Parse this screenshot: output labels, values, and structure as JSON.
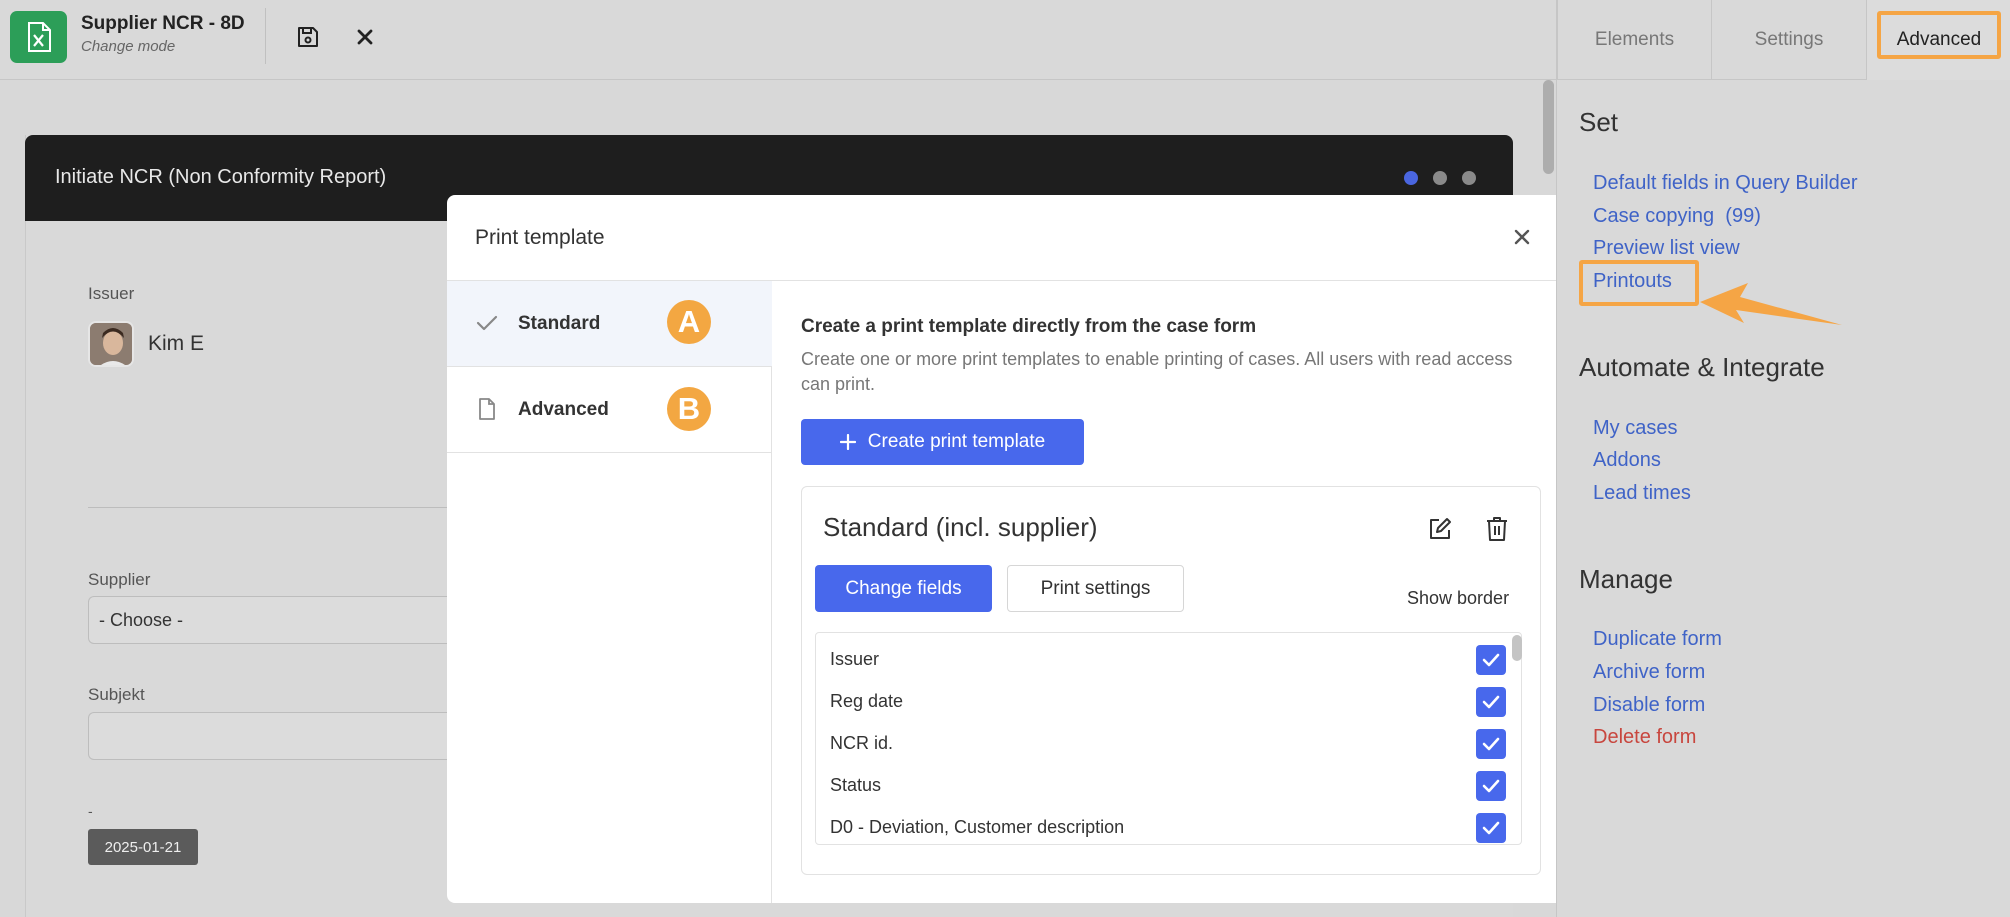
{
  "app": {
    "form_title": "Supplier NCR - 8D",
    "mode": "Change mode",
    "brand_color": "#2c9e58"
  },
  "toolbar": {
    "save_icon": "floppy-disk-icon",
    "close_icon": "close-icon"
  },
  "right_tabs": [
    "Elements",
    "Settings",
    "Advanced"
  ],
  "right_panel": {
    "set_heading": "Set",
    "set_links": [
      "Default fields in Query Builder",
      "Case copying  (99)",
      "Preview list view",
      "Printouts"
    ],
    "automate_heading": "Automate & Integrate",
    "automate_links": [
      "My cases",
      "Addons",
      "Lead times"
    ],
    "manage_heading": "Manage",
    "manage_links": [
      "Duplicate form",
      "Archive form",
      "Disable form",
      "Delete form"
    ]
  },
  "background_form": {
    "header_title": "Initiate NCR (Non Conformity Report)",
    "issuer_label": "Issuer",
    "issuer_name": "Kim E",
    "supplier_label": "Supplier",
    "supplier_value": "- Choose -",
    "subject_label": "Subjekt",
    "date_label": "-",
    "date_value": "2025-01-21"
  },
  "modal": {
    "title": "Print template",
    "sidebar": [
      {
        "label": "Standard",
        "badge": "A",
        "icon": "check-icon"
      },
      {
        "label": "Advanced",
        "badge": "B",
        "icon": "document-icon"
      }
    ],
    "content_title": "Create a print template directly from the case form",
    "content_desc": "Create one or more print templates to enable printing of cases. All users with read access can print.",
    "create_button": "Create print template",
    "template": {
      "name": "Standard (incl. supplier)",
      "change_fields": "Change fields",
      "print_settings": "Print settings",
      "show_border": "Show border",
      "fields": [
        {
          "name": "Issuer",
          "checked": true
        },
        {
          "name": "Reg date",
          "checked": true
        },
        {
          "name": "NCR id.",
          "checked": true
        },
        {
          "name": "Status",
          "checked": true
        },
        {
          "name": "D0 - Deviation, Customer description",
          "checked": true
        }
      ]
    }
  },
  "colors": {
    "accent": "#4868ec",
    "highlight": "#f5a545",
    "link": "#3f63c7",
    "danger": "#c8463e"
  }
}
